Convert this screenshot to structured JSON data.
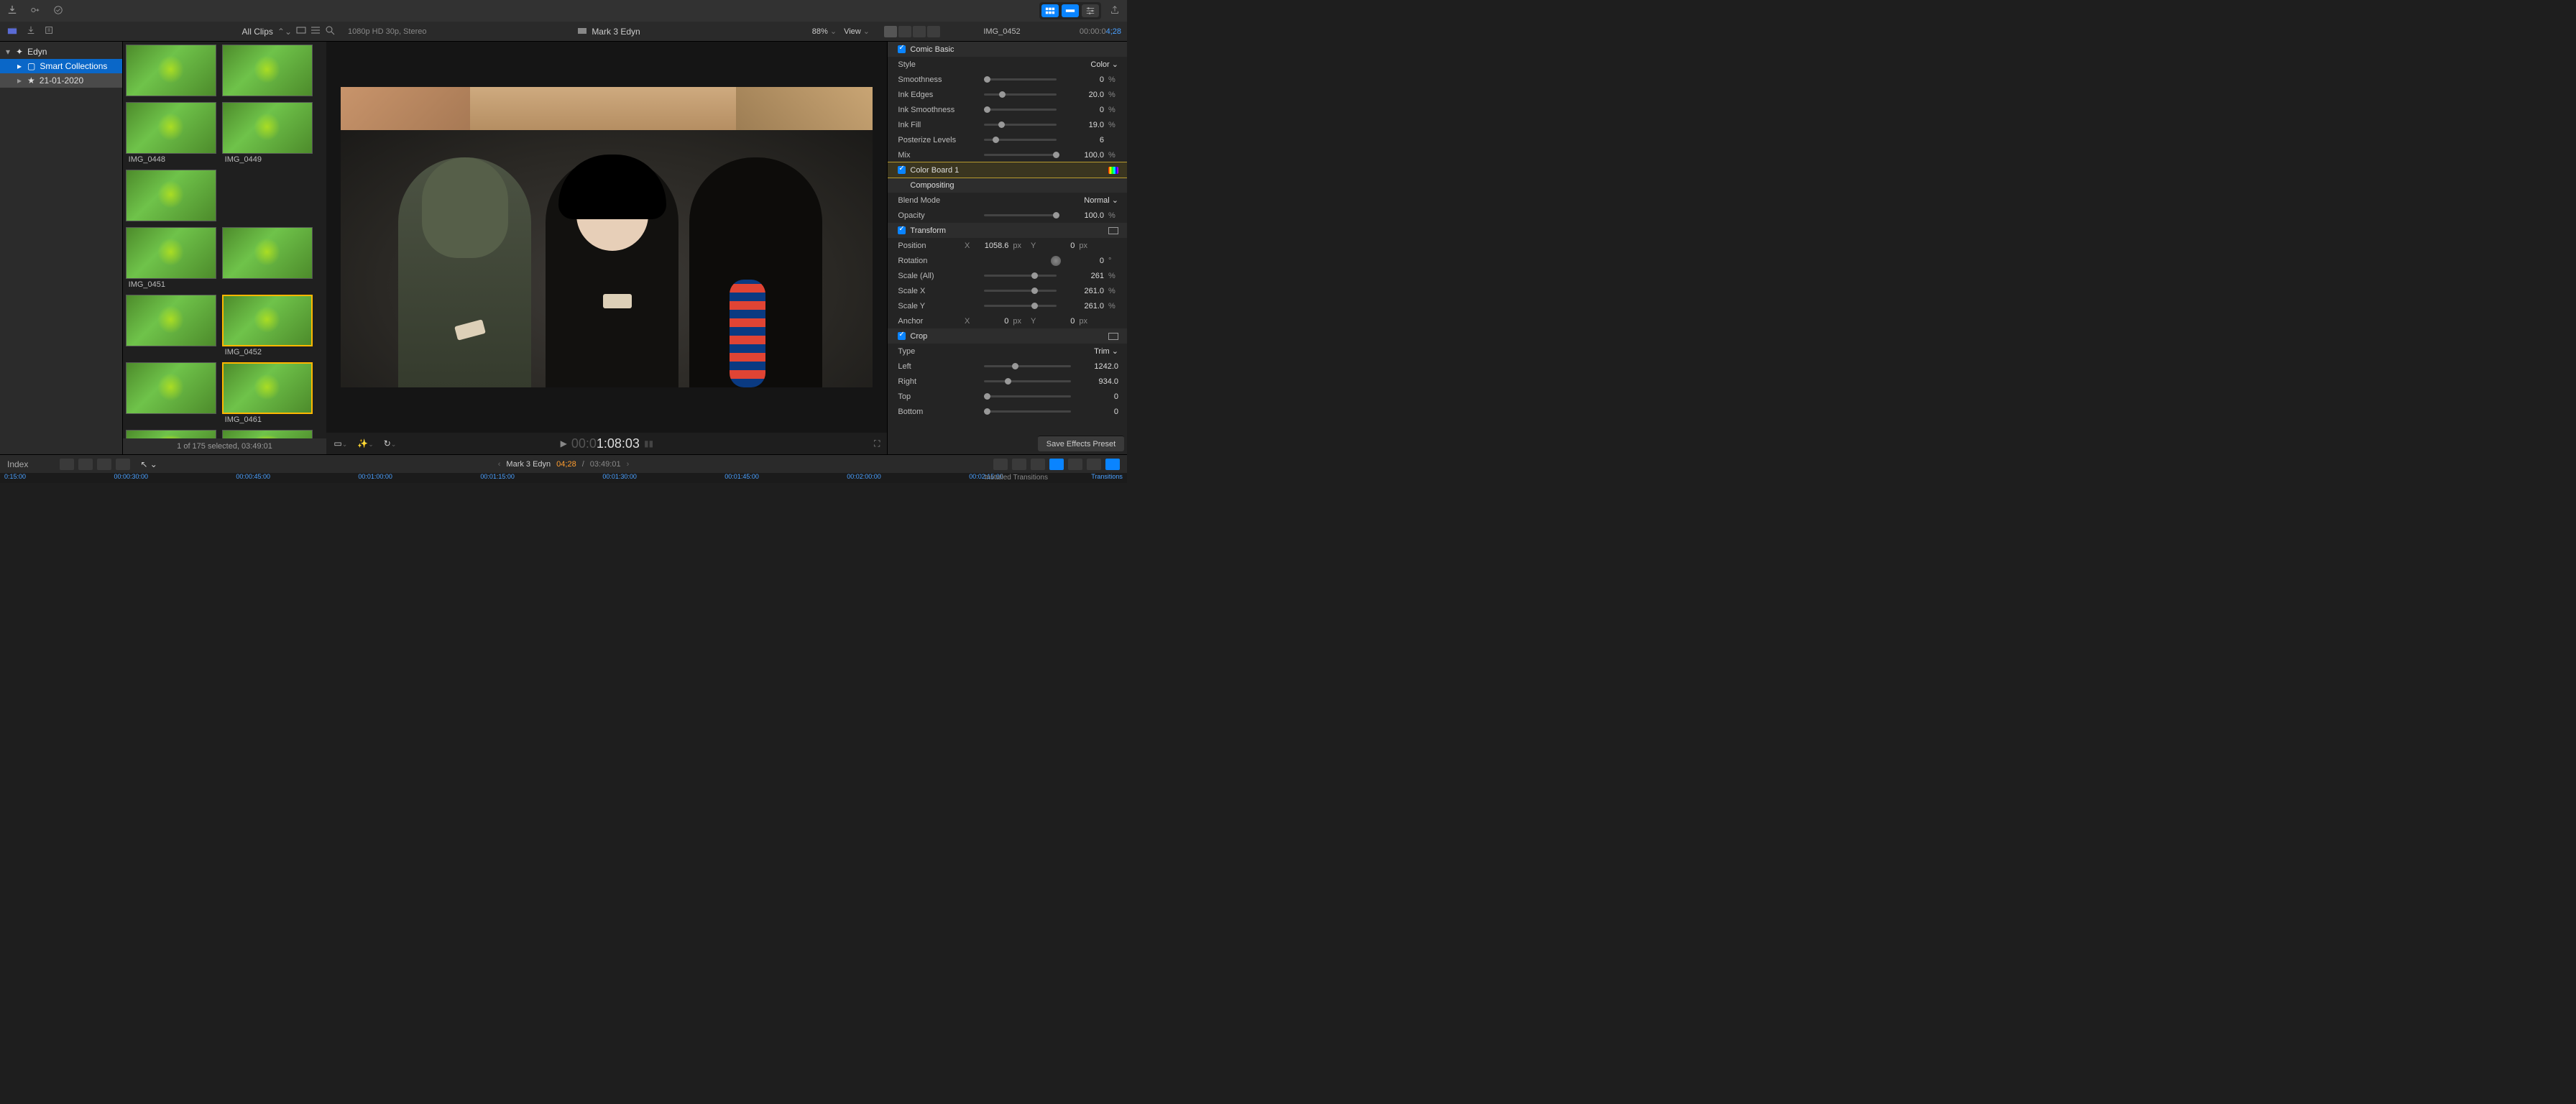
{
  "sysbar": {
    "download_icon": "download",
    "key_icon": "key",
    "check_icon": "check-circle"
  },
  "toolbar": {
    "all_clips_label": "All Clips",
    "format_info": "1080p HD 30p, Stereo",
    "project_title": "Mark 3 Edyn",
    "zoom_percent": "88%",
    "view_label": "View"
  },
  "inspector_header": {
    "clip_name": "IMG_0452",
    "tc_prefix": "00:00:0",
    "tc_value": "4;28"
  },
  "library": {
    "root": "Edyn",
    "smart": "Smart Collections",
    "event": "21-01-2020"
  },
  "browser": {
    "clips": [
      {
        "name": "IMG_0448"
      },
      {
        "name": "IMG_0449"
      },
      {
        "name": ""
      },
      {
        "name": "IMG_0451"
      },
      {
        "name": ""
      },
      {
        "name": "IMG_0452"
      },
      {
        "name": ""
      },
      {
        "name": "IMG_0461"
      }
    ],
    "status": "1 of 175 selected, 03:49:01"
  },
  "viewer": {
    "play_tc_dim": "00:0",
    "play_tc_bright": "1:08:03"
  },
  "timeline": {
    "index_label": "Index",
    "project": "Mark 3 Edyn",
    "current_tc": "04;28",
    "sep": " / ",
    "duration": "03:49:01",
    "transitions_label": "Installed Transitions",
    "ruler": [
      "0:15:00",
      "00:00:30:00",
      "00:00:45:00",
      "00:01:00:00",
      "00:01:15:00",
      "00:01:30:00",
      "00:01:45:00",
      "00:02:00:00",
      "00:02:15:00"
    ],
    "trans_word": "Transitions"
  },
  "insp": {
    "comic_basic": "Comic Basic",
    "style_label": "Style",
    "style_value": "Color",
    "smoothness_label": "Smoothness",
    "smoothness_value": "0",
    "ink_edges_label": "Ink Edges",
    "ink_edges_value": "20.0",
    "ink_smooth_label": "Ink Smoothness",
    "ink_smooth_value": "0",
    "ink_fill_label": "Ink Fill",
    "ink_fill_value": "19.0",
    "posterize_label": "Posterize Levels",
    "posterize_value": "6",
    "mix_label": "Mix",
    "mix_value": "100.0",
    "color_board": "Color Board 1",
    "compositing": "Compositing",
    "blend_label": "Blend Mode",
    "blend_value": "Normal",
    "opacity_label": "Opacity",
    "opacity_value": "100.0",
    "transform": "Transform",
    "position_label": "Position",
    "position_x": "1058.6",
    "position_y": "0",
    "rotation_label": "Rotation",
    "rotation_value": "0",
    "scale_all_label": "Scale (All)",
    "scale_all_value": "261",
    "scale_x_label": "Scale X",
    "scale_x_value": "261.0",
    "scale_y_label": "Scale Y",
    "scale_y_value": "261.0",
    "anchor_label": "Anchor",
    "anchor_x": "0",
    "anchor_y": "0",
    "crop": "Crop",
    "crop_type_label": "Type",
    "crop_type_value": "Trim",
    "left_label": "Left",
    "left_value": "1242.0",
    "right_label": "Right",
    "right_value": "934.0",
    "top_label": "Top",
    "top_value": "0",
    "bottom_label": "Bottom",
    "bottom_value": "0",
    "save_preset": "Save Effects Preset",
    "pct": "%",
    "px": "px",
    "deg": "°",
    "X": "X",
    "Y": "Y"
  }
}
